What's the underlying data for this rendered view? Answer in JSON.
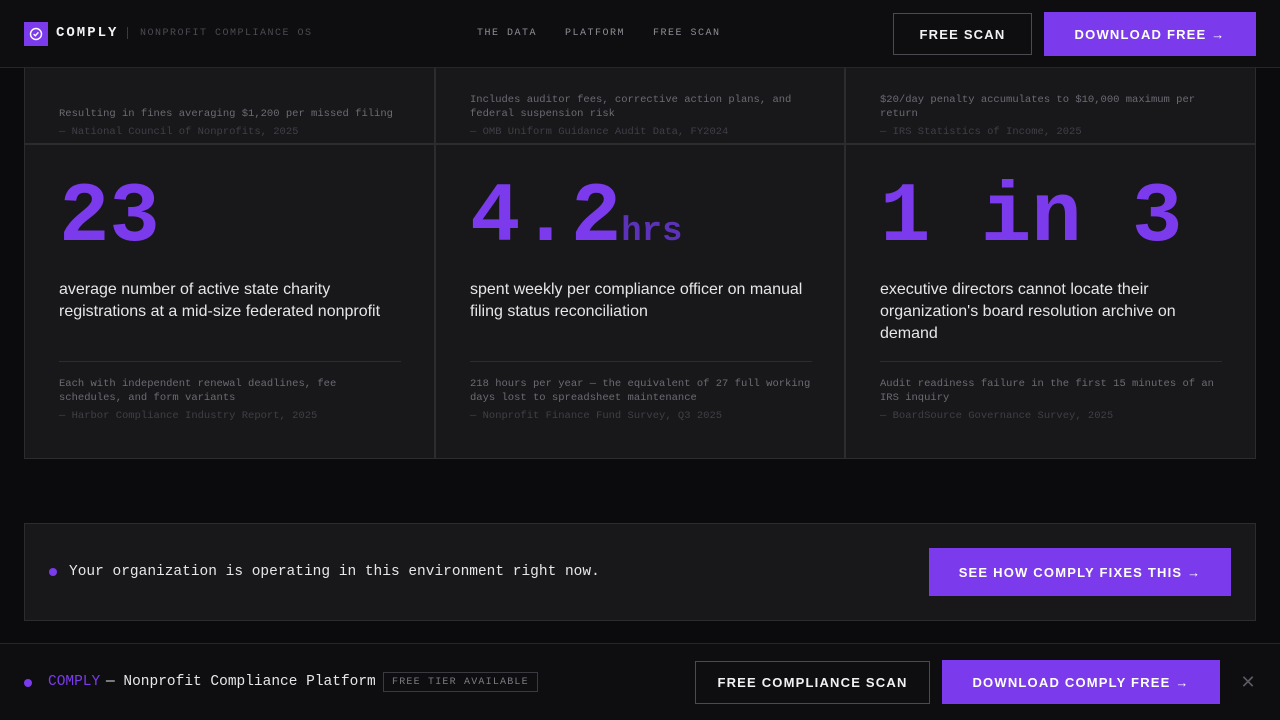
{
  "header": {
    "brand": "COMPLY",
    "tagline": "NONPROFIT COMPLIANCE OS",
    "nav": [
      "THE DATA",
      "PLATFORM",
      "FREE SCAN"
    ],
    "free_scan_button": "FREE SCAN",
    "download_button": "DOWNLOAD FREE →"
  },
  "top_cards": [
    {
      "note": "Resulting in fines averaging $1,200 per missed filing",
      "source": "— National Council of Nonprofits, 2025"
    },
    {
      "note": "Includes auditor fees, corrective action plans, and federal suspension risk",
      "source": "— OMB Uniform Guidance Audit Data, FY2024"
    },
    {
      "note": "$20/day penalty accumulates to $10,000 maximum per return",
      "source": "— IRS Statistics of Income, 2025"
    }
  ],
  "cards": [
    {
      "stat": "23",
      "unit": "",
      "description": "average number of active state charity registrations at a mid-size federated nonprofit",
      "note": "Each with independent renewal deadlines, fee schedules, and form variants",
      "source": "— Harbor Compliance Industry Report, 2025"
    },
    {
      "stat": "4.2",
      "unit": "hrs",
      "description": "spent weekly per compliance officer on manual filing status reconciliation",
      "note": "218 hours per year — the equivalent of 27 full working days lost to spreadsheet maintenance",
      "source": "— Nonprofit Finance Fund Survey, Q3 2025"
    },
    {
      "stat": "1 in 3",
      "unit": "",
      "description": "executive directors cannot locate their organization's board resolution archive on demand",
      "note": "Audit readiness failure in the first 15 minutes of an IRS inquiry",
      "source": "— BoardSource Governance Survey, 2025"
    }
  ],
  "banner": {
    "text": "Your organization is operating in this environment right now.",
    "button": "SEE HOW COMPLY FIXES THIS →"
  },
  "bottom_bar": {
    "brand": "COMPLY",
    "rest": "— Nonprofit Compliance Platform",
    "badge": "FREE TIER AVAILABLE",
    "scan_button": "FREE COMPLIANCE SCAN",
    "download_button": "DOWNLOAD COMPLY FREE →",
    "close": "✕"
  },
  "colors": {
    "accent": "#7c3aed",
    "background": "#0b0b0d",
    "card": "#18181b"
  }
}
